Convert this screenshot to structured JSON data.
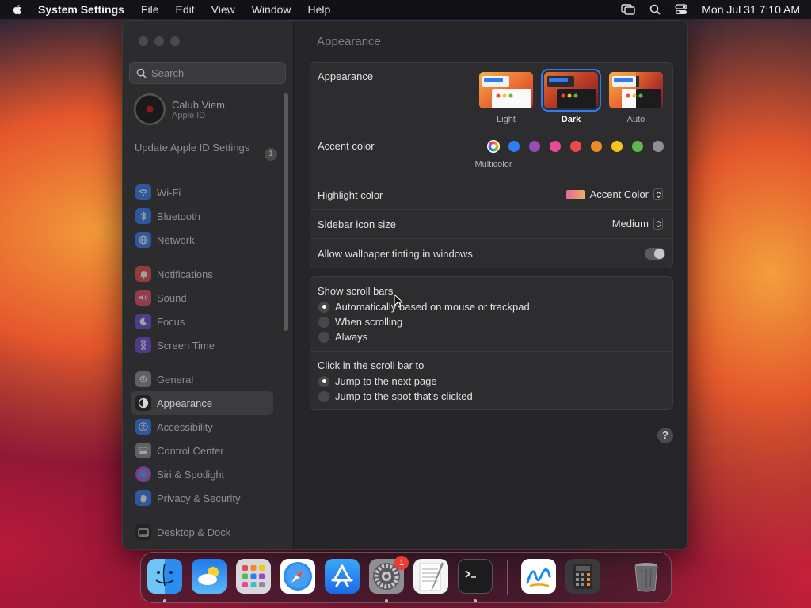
{
  "menubar": {
    "app_name": "System Settings",
    "items": [
      "File",
      "Edit",
      "View",
      "Window",
      "Help"
    ],
    "datetime": "Mon Jul 31  7:10 AM"
  },
  "sidebar": {
    "search_placeholder": "Search",
    "profile": {
      "name": "Calub Viem",
      "subtitle": "Apple ID"
    },
    "update": {
      "label": "Update Apple ID Settings",
      "count": "1"
    },
    "groups": [
      [
        {
          "label": "Wi-Fi",
          "icon": "wifi-icon",
          "color": "#2f7cf6"
        },
        {
          "label": "Bluetooth",
          "icon": "bluetooth-icon",
          "color": "#2f7cf6"
        },
        {
          "label": "Network",
          "icon": "globe-icon",
          "color": "#2f7cf6"
        }
      ],
      [
        {
          "label": "Notifications",
          "icon": "bell-icon",
          "color": "#e84a4a"
        },
        {
          "label": "Sound",
          "icon": "speaker-icon",
          "color": "#e84a6a"
        },
        {
          "label": "Focus",
          "icon": "moon-icon",
          "color": "#6a4ad8"
        },
        {
          "label": "Screen Time",
          "icon": "hourglass-icon",
          "color": "#6a4ad8"
        }
      ],
      [
        {
          "label": "General",
          "icon": "gear-icon",
          "color": "#8e8e93"
        },
        {
          "label": "Appearance",
          "icon": "appearance-icon",
          "color": "#1c1c1e",
          "active": true
        },
        {
          "label": "Accessibility",
          "icon": "accessibility-icon",
          "color": "#2f7cf6"
        },
        {
          "label": "Control Center",
          "icon": "control-center-icon",
          "color": "#8e8e93"
        },
        {
          "label": "Siri & Spotlight",
          "icon": "siri-icon",
          "color": "#d04ad8"
        },
        {
          "label": "Privacy & Security",
          "icon": "hand-icon",
          "color": "#2f7cf6"
        }
      ],
      [
        {
          "label": "Desktop & Dock",
          "icon": "dock-icon",
          "color": "#1c1c1e"
        }
      ]
    ]
  },
  "content": {
    "title": "Appearance",
    "appearance": {
      "label": "Appearance",
      "options": [
        "Light",
        "Dark",
        "Auto"
      ],
      "selected": "Dark"
    },
    "accent": {
      "label": "Accent color",
      "caption": "Multicolor",
      "colors": [
        "#2f7cf6",
        "#9a4ab8",
        "#e84a9a",
        "#ea4a4a",
        "#f08a24",
        "#f5c41a",
        "#5cb84a",
        "#8e8e93"
      ]
    },
    "highlight": {
      "label": "Highlight color",
      "value": "Accent Color"
    },
    "sidebar_icon": {
      "label": "Sidebar icon size",
      "value": "Medium"
    },
    "wallpaper": {
      "label": "Allow wallpaper tinting in windows",
      "enabled": false
    },
    "scrollbars": {
      "label": "Show scroll bars",
      "options": [
        "Automatically based on mouse or trackpad",
        "When scrolling",
        "Always"
      ],
      "selected": 0
    },
    "click": {
      "label": "Click in the scroll bar to",
      "options": [
        "Jump to the next page",
        "Jump to the spot that's clicked"
      ],
      "selected": 0
    },
    "help": "?"
  },
  "dock": {
    "apps": [
      {
        "name": "Finder",
        "icon": "finder-icon",
        "running": true
      },
      {
        "name": "Weather",
        "icon": "weather-icon",
        "running": false
      },
      {
        "name": "Launchpad",
        "icon": "launchpad-icon",
        "running": false
      },
      {
        "name": "Safari",
        "icon": "safari-icon",
        "running": false
      },
      {
        "name": "App Store",
        "icon": "app-store-icon",
        "running": false
      },
      {
        "name": "System Settings",
        "icon": "system-settings-icon",
        "running": true,
        "badge": "1"
      },
      {
        "name": "TextEdit",
        "icon": "textedit-icon",
        "running": false
      },
      {
        "name": "Terminal",
        "icon": "terminal-icon",
        "running": true
      },
      {
        "name": "Freeform",
        "icon": "freeform-icon",
        "running": false
      },
      {
        "name": "Calculator",
        "icon": "calculator-icon",
        "running": false
      },
      {
        "name": "Trash",
        "icon": "trash-icon",
        "running": false
      }
    ]
  }
}
